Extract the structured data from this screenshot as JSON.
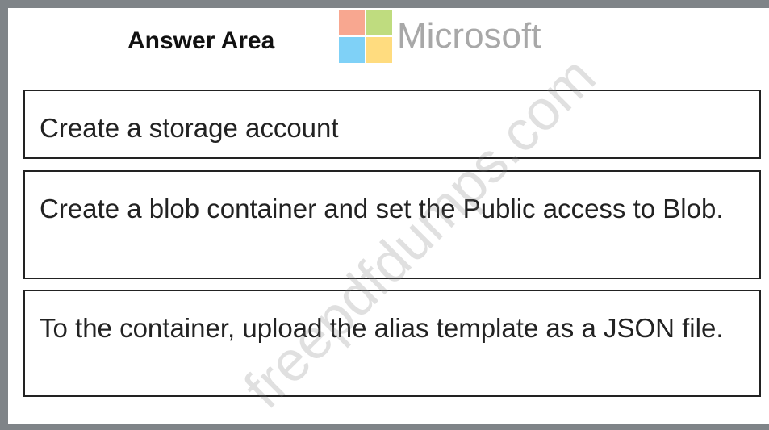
{
  "header": {
    "title": "Answer Area",
    "brand_text": "Microsoft"
  },
  "steps": [
    {
      "text": "Create a storage account"
    },
    {
      "text": "Create a blob container and set the Public access to Blob."
    },
    {
      "text": "To the container, upload the alias template as a JSON file."
    }
  ],
  "watermark": {
    "text": "freepdfdumps.com"
  },
  "colors": {
    "frame": "#7f8488",
    "box_border": "#222222",
    "logo_red": "#f25022",
    "logo_green": "#7fba00",
    "logo_blue": "#00a4ef",
    "logo_yellow": "#ffb900"
  },
  "icons": {
    "logo": "microsoft-logo-icon"
  }
}
